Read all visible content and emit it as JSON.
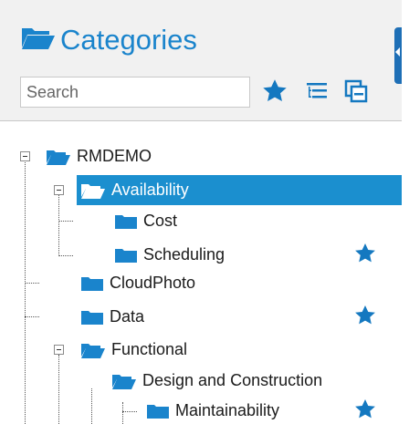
{
  "header": {
    "title": "Categories",
    "search": {
      "placeholder": "Search",
      "value": ""
    }
  },
  "colors": {
    "accent": "#1a84cc",
    "selected_bg": "#1b8fcf",
    "star": "#1478c0",
    "folder": "#1a84cc"
  },
  "tree": {
    "nodes": [
      {
        "label": "RMDEMO",
        "expanded": true,
        "starred": false,
        "selected": false
      },
      {
        "label": "Availability",
        "expanded": true,
        "starred": false,
        "selected": true
      },
      {
        "label": "Cost",
        "expanded": false,
        "starred": false,
        "selected": false
      },
      {
        "label": "Scheduling",
        "expanded": false,
        "starred": true,
        "selected": false
      },
      {
        "label": "CloudPhoto",
        "expanded": false,
        "starred": false,
        "selected": false
      },
      {
        "label": "Data",
        "expanded": false,
        "starred": true,
        "selected": false
      },
      {
        "label": "Functional",
        "expanded": true,
        "starred": false,
        "selected": false
      },
      {
        "label": "Design and Construction",
        "expanded": true,
        "starred": false,
        "selected": false
      },
      {
        "label": "Maintainability",
        "expanded": false,
        "starred": true,
        "selected": false
      }
    ]
  },
  "icons": {
    "title": "folder-open-icon",
    "toolbar": [
      "star-icon",
      "tree-list-icon",
      "collapse-all-icon"
    ]
  }
}
